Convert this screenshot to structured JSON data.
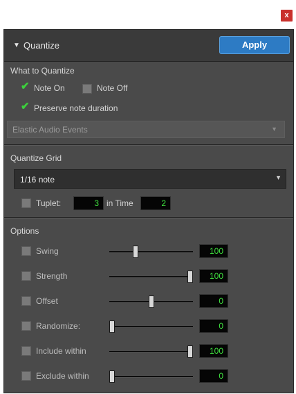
{
  "close": {
    "glyph": "x"
  },
  "header": {
    "arrow": "▼",
    "title": "Quantize",
    "apply_label": "Apply"
  },
  "what": {
    "title": "What to Quantize",
    "note_on": {
      "label": "Note On",
      "checked": true
    },
    "note_off": {
      "label": "Note Off",
      "checked": false
    },
    "preserve": {
      "label": "Preserve note duration",
      "checked": true
    },
    "elastic_dropdown": {
      "value": "Elastic Audio Events",
      "arrow": "▼"
    }
  },
  "grid": {
    "title": "Quantize Grid",
    "dropdown": {
      "value": "1/16 note",
      "arrow": "▼"
    },
    "tuplet_label": "Tuplet:",
    "tuplet_value": "3",
    "in_time_label": "in Time",
    "in_time_value": "2"
  },
  "options": {
    "title": "Options",
    "rows": [
      {
        "label": "Swing",
        "value": "100",
        "checked": false,
        "slider_fraction": 0.3
      },
      {
        "label": "Strength",
        "value": "100",
        "checked": false,
        "slider_fraction": 1.0
      },
      {
        "label": "Offset",
        "value": "0",
        "checked": false,
        "slider_fraction": 0.5
      },
      {
        "label": "Randomize:",
        "value": "0",
        "checked": false,
        "slider_fraction": 0.0
      },
      {
        "label": "Include within",
        "value": "100",
        "checked": false,
        "slider_fraction": 1.0
      },
      {
        "label": "Exclude within",
        "value": "0",
        "checked": false,
        "slider_fraction": 0.0
      }
    ]
  },
  "colors": {
    "accent": "#2d7bc4",
    "check": "#3cd13c",
    "value_text": "#3fe03f",
    "close": "#c9302c"
  },
  "icons": {
    "close": "close-icon",
    "collapse": "triangle-down-icon",
    "check": "checkmark-icon"
  }
}
